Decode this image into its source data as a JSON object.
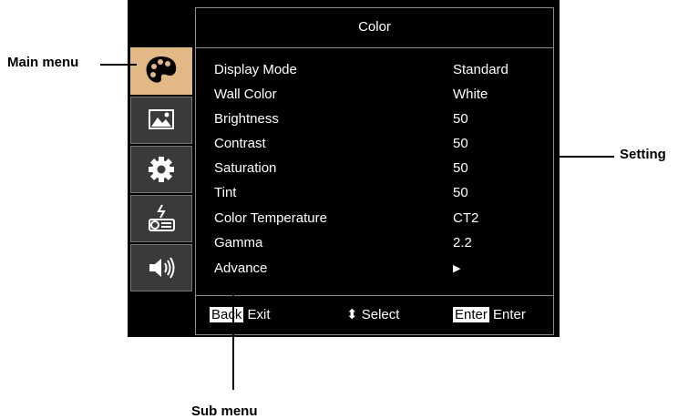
{
  "osd": {
    "title": "Color",
    "tabs": [
      {
        "icon": "palette-icon",
        "active": true
      },
      {
        "icon": "picture-icon",
        "active": false
      },
      {
        "icon": "gear-icon",
        "active": false
      },
      {
        "icon": "projector-icon",
        "active": false
      },
      {
        "icon": "speaker-icon",
        "active": false
      }
    ],
    "items": [
      {
        "label": "Display Mode",
        "value": "Standard"
      },
      {
        "label": "Wall Color",
        "value": "White"
      },
      {
        "label": "Brightness",
        "value": "50"
      },
      {
        "label": "Contrast",
        "value": "50"
      },
      {
        "label": "Saturation",
        "value": "50"
      },
      {
        "label": "Tint",
        "value": "50"
      },
      {
        "label": "Color Temperature",
        "value": "CT2"
      },
      {
        "label": "Gamma",
        "value": "2.2"
      },
      {
        "label": "Advance",
        "value": "▶"
      }
    ],
    "footer": {
      "back_key": "Back",
      "exit_label": "Exit",
      "select_symbol": "⬍",
      "select_label": "Select",
      "enter_key": "Enter",
      "enter_label": "Enter"
    }
  },
  "callouts": {
    "main_menu": "Main menu",
    "setting": "Setting",
    "sub_menu": "Sub menu"
  },
  "colors": {
    "osd_background": "#000000",
    "active_tab": "#e2b884",
    "inactive_tab": "#3a3a3a"
  }
}
